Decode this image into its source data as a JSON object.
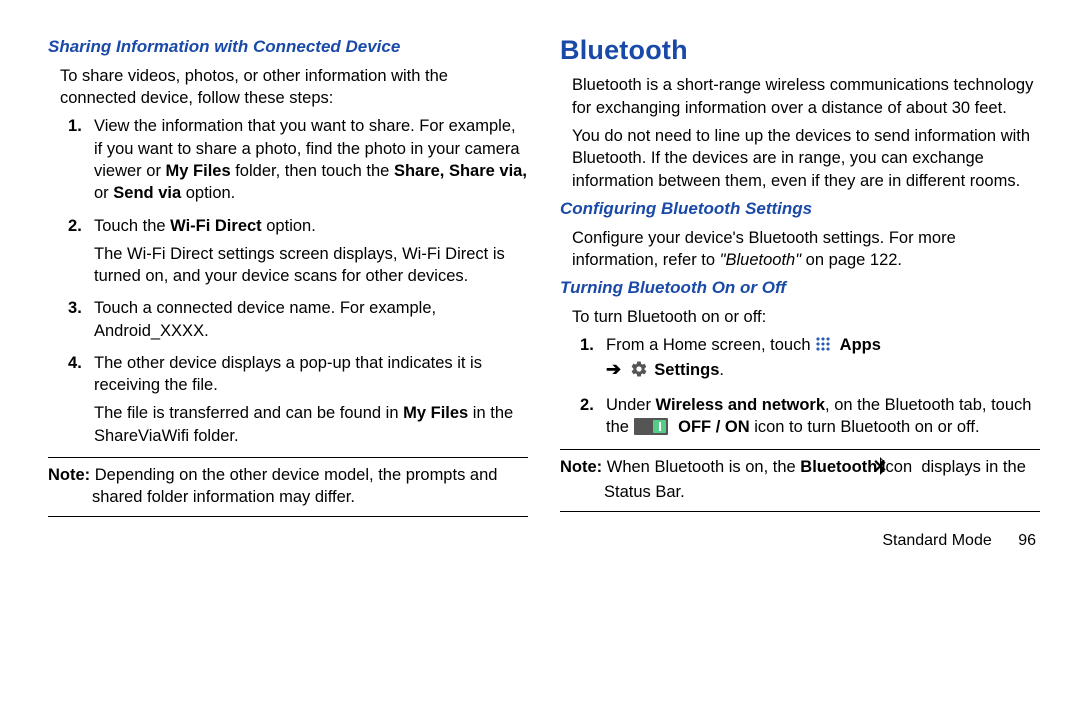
{
  "left": {
    "heading": "Sharing Information with Connected Device",
    "intro": "To share videos, photos, or other information with the connected device, follow these steps:",
    "steps": {
      "s1a": "View the information that you want to share. For example, if you want to share a photo, find the photo in your camera viewer or ",
      "s1b": "My Files",
      "s1c": " folder, then touch the ",
      "s1d": "Share, Share via,",
      "s1e": " or ",
      "s1f": "Send via",
      "s1g": " option.",
      "s2a": "Touch the ",
      "s2b": "Wi-Fi Direct",
      "s2c": " option.",
      "s2p": "The Wi-Fi Direct settings screen displays, Wi-Fi Direct is turned on, and your device scans for other devices.",
      "s3": "Touch a connected device name. For example, Android_XXXX.",
      "s4": "The other device displays a pop-up that indicates it is receiving the file.",
      "s4pA": "The file is transferred and can be found in ",
      "s4pB": "My Files",
      "s4pC": " in the ShareViaWifi folder."
    },
    "noteLabel": "Note:",
    "noteText": " Depending on the other device model, the prompts and shared folder information may differ."
  },
  "right": {
    "title": "Bluetooth",
    "p1": "Bluetooth is a short-range wireless communications technology for exchanging information over a distance of about 30 feet.",
    "p2": "You do not need to line up the devices to send information with Bluetooth. If the devices are in range, you can exchange information between them, even if they are in different rooms.",
    "h2a": "Configuring Bluetooth Settings",
    "cfgA": "Configure your device's Bluetooth settings. For more information, refer to ",
    "cfgB": "\"Bluetooth\"",
    "cfgC": " on page 122.",
    "h2b": "Turning Bluetooth On or Off",
    "turnIntro": "To turn Bluetooth on or off:",
    "step1a": "From a Home screen, touch ",
    "apps": "Apps",
    "arrow": "➔",
    "settings": "Settings",
    "step2a": "Under ",
    "step2b": "Wireless and network",
    "step2c": ", on the Bluetooth tab, touch the ",
    "step2d": "OFF / ON",
    "step2e": " icon to turn Bluetooth on or off.",
    "note2Label": "Note:",
    "note2a": " When Bluetooth is on, the ",
    "note2b": "Bluetooth",
    "note2c": " icon ",
    "note2d": " displays in the Status Bar."
  },
  "footer": {
    "section": "Standard Mode",
    "page": "96"
  }
}
